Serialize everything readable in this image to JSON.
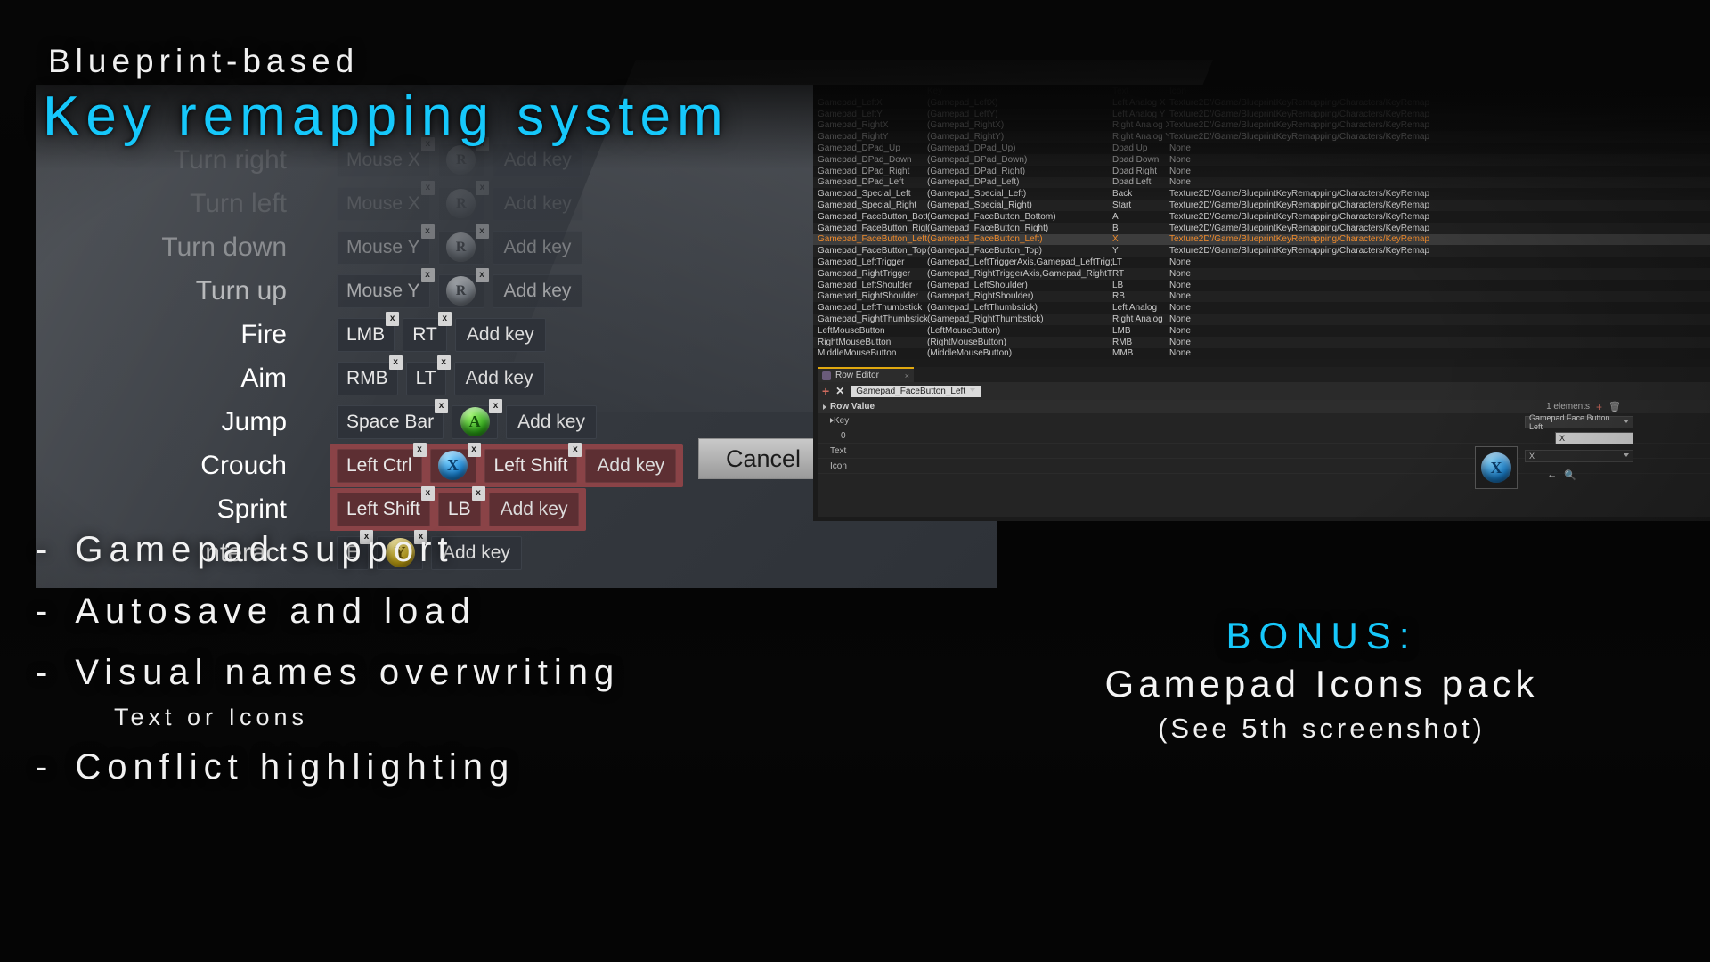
{
  "marketing": {
    "eyebrow": "Blueprint-based",
    "headline": "Key remapping system",
    "bullets": [
      {
        "dash": "-",
        "text": "Gamepad support"
      },
      {
        "dash": "-",
        "text": "Autosave and load"
      },
      {
        "dash": "-",
        "text": "Visual names overwriting",
        "sub": "Text or Icons"
      },
      {
        "dash": "-",
        "text": "Conflict highlighting"
      }
    ],
    "bonus": {
      "line1": "BONUS:",
      "line2": "Gamepad Icons pack",
      "line3": "(See 5th screenshot)"
    },
    "accent_color": "#16c8fb"
  },
  "game_menu": {
    "cancel_label": "Cancel",
    "add_key_label": "Add key",
    "remove_glyph": "x",
    "bindings": [
      {
        "action": "Turn right",
        "opacity": "ghost",
        "keys": [
          {
            "type": "text",
            "label": "Mouse X"
          },
          {
            "type": "pad",
            "glyph": "R",
            "color": "grey"
          }
        ],
        "conflict": false
      },
      {
        "action": "Turn left",
        "opacity": "ghost",
        "keys": [
          {
            "type": "text",
            "label": "Mouse X"
          },
          {
            "type": "pad",
            "glyph": "R",
            "color": "grey"
          }
        ],
        "conflict": false
      },
      {
        "action": "Turn down",
        "opacity": "fade1",
        "keys": [
          {
            "type": "text",
            "label": "Mouse Y"
          },
          {
            "type": "pad",
            "glyph": "R",
            "color": "grey"
          }
        ],
        "conflict": false
      },
      {
        "action": "Turn up",
        "opacity": "fade2",
        "keys": [
          {
            "type": "text",
            "label": "Mouse Y"
          },
          {
            "type": "pad",
            "glyph": "R",
            "color": "grey"
          }
        ],
        "conflict": false
      },
      {
        "action": "Fire",
        "opacity": "",
        "keys": [
          {
            "type": "text",
            "label": "LMB"
          },
          {
            "type": "text",
            "label": "RT"
          }
        ],
        "conflict": false
      },
      {
        "action": "Aim",
        "opacity": "",
        "keys": [
          {
            "type": "text",
            "label": "RMB"
          },
          {
            "type": "text",
            "label": "LT"
          }
        ],
        "conflict": false
      },
      {
        "action": "Jump",
        "opacity": "",
        "keys": [
          {
            "type": "text",
            "label": "Space Bar"
          },
          {
            "type": "pad",
            "glyph": "A",
            "color": "green"
          }
        ],
        "conflict": false
      },
      {
        "action": "Crouch",
        "opacity": "",
        "keys": [
          {
            "type": "text",
            "label": "Left Ctrl"
          },
          {
            "type": "pad",
            "glyph": "X",
            "color": "blue"
          },
          {
            "type": "text",
            "label": "Left Shift"
          }
        ],
        "conflict": true
      },
      {
        "action": "Sprint",
        "opacity": "",
        "keys": [
          {
            "type": "text",
            "label": "Left Shift"
          },
          {
            "type": "text",
            "label": "LB"
          }
        ],
        "conflict": true
      },
      {
        "action": "Interact",
        "opacity": "",
        "keys": [
          {
            "type": "text",
            "label": "E"
          },
          {
            "type": "pad",
            "glyph": "Y",
            "color": "yellow"
          }
        ],
        "conflict": false
      }
    ]
  },
  "editor": {
    "table": {
      "columns": [
        "",
        "Key",
        "Text",
        "Icon"
      ],
      "rows": [
        {
          "name": "Gamepad_LeftX",
          "key": "(Gamepad_LeftX)",
          "text": "Left Analog X",
          "icon": "Texture2D'/Game/BlueprintKeyRemapping/Characters/KeyRemap",
          "selected": false
        },
        {
          "name": "Gamepad_LeftY",
          "key": "(Gamepad_LeftY)",
          "text": "Left Analog Y",
          "icon": "Texture2D'/Game/BlueprintKeyRemapping/Characters/KeyRemap",
          "selected": false
        },
        {
          "name": "Gamepad_RightX",
          "key": "(Gamepad_RightX)",
          "text": "Right Analog X",
          "icon": "Texture2D'/Game/BlueprintKeyRemapping/Characters/KeyRemap",
          "selected": false
        },
        {
          "name": "Gamepad_RightY",
          "key": "(Gamepad_RightY)",
          "text": "Right Analog Y",
          "icon": "Texture2D'/Game/BlueprintKeyRemapping/Characters/KeyRemap",
          "selected": false
        },
        {
          "name": "Gamepad_DPad_Up",
          "key": "(Gamepad_DPad_Up)",
          "text": "Dpad Up",
          "icon": "None",
          "selected": false
        },
        {
          "name": "Gamepad_DPad_Down",
          "key": "(Gamepad_DPad_Down)",
          "text": "Dpad Down",
          "icon": "None",
          "selected": false
        },
        {
          "name": "Gamepad_DPad_Right",
          "key": "(Gamepad_DPad_Right)",
          "text": "Dpad Right",
          "icon": "None",
          "selected": false
        },
        {
          "name": "Gamepad_DPad_Left",
          "key": "(Gamepad_DPad_Left)",
          "text": "Dpad Left",
          "icon": "None",
          "selected": false
        },
        {
          "name": "Gamepad_Special_Left",
          "key": "(Gamepad_Special_Left)",
          "text": "Back",
          "icon": "Texture2D'/Game/BlueprintKeyRemapping/Characters/KeyRemap",
          "selected": false
        },
        {
          "name": "Gamepad_Special_Right",
          "key": "(Gamepad_Special_Right)",
          "text": "Start",
          "icon": "Texture2D'/Game/BlueprintKeyRemapping/Characters/KeyRemap",
          "selected": false
        },
        {
          "name": "Gamepad_FaceButton_Bottom",
          "key": "(Gamepad_FaceButton_Bottom)",
          "text": "A",
          "icon": "Texture2D'/Game/BlueprintKeyRemapping/Characters/KeyRemap",
          "selected": false
        },
        {
          "name": "Gamepad_FaceButton_Right",
          "key": "(Gamepad_FaceButton_Right)",
          "text": "B",
          "icon": "Texture2D'/Game/BlueprintKeyRemapping/Characters/KeyRemap",
          "selected": false
        },
        {
          "name": "Gamepad_FaceButton_Left",
          "key": "(Gamepad_FaceButton_Left)",
          "text": "X",
          "icon": "Texture2D'/Game/BlueprintKeyRemapping/Characters/KeyRemap",
          "selected": true
        },
        {
          "name": "Gamepad_FaceButton_Top",
          "key": "(Gamepad_FaceButton_Top)",
          "text": "Y",
          "icon": "Texture2D'/Game/BlueprintKeyRemapping/Characters/KeyRemap",
          "selected": false
        },
        {
          "name": "Gamepad_LeftTrigger",
          "key": "(Gamepad_LeftTriggerAxis,Gamepad_LeftTrigger)",
          "text": "LT",
          "icon": "None",
          "selected": false
        },
        {
          "name": "Gamepad_RightTrigger",
          "key": "(Gamepad_RightTriggerAxis,Gamepad_RightTrigger)",
          "text": "RT",
          "icon": "None",
          "selected": false
        },
        {
          "name": "Gamepad_LeftShoulder",
          "key": "(Gamepad_LeftShoulder)",
          "text": "LB",
          "icon": "None",
          "selected": false
        },
        {
          "name": "Gamepad_RightShoulder",
          "key": "(Gamepad_RightShoulder)",
          "text": "RB",
          "icon": "None",
          "selected": false
        },
        {
          "name": "Gamepad_LeftThumbstick",
          "key": "(Gamepad_LeftThumbstick)",
          "text": "Left Analog",
          "icon": "None",
          "selected": false
        },
        {
          "name": "Gamepad_RightThumbstick",
          "key": "(Gamepad_RightThumbstick)",
          "text": "Right Analog",
          "icon": "None",
          "selected": false
        },
        {
          "name": "LeftMouseButton",
          "key": "(LeftMouseButton)",
          "text": "LMB",
          "icon": "None",
          "selected": false
        },
        {
          "name": "RightMouseButton",
          "key": "(RightMouseButton)",
          "text": "RMB",
          "icon": "None",
          "selected": false
        },
        {
          "name": "MiddleMouseButton",
          "key": "(MiddleMouseButton)",
          "text": "MMB",
          "icon": "None",
          "selected": false
        }
      ]
    },
    "row_editor": {
      "tab_label": "Row Editor",
      "tab_close": "×",
      "add_label": "+",
      "remove_label": "✕",
      "selected_row": "Gamepad_FaceButton_Left",
      "section_label": "Row Value",
      "properties": [
        {
          "label": "Key"
        },
        {
          "label": "0"
        },
        {
          "label": "Text"
        },
        {
          "label": "Icon"
        }
      ],
      "elements_count": "1 elements",
      "key_value": "Gamepad Face Button Left",
      "text_value": "X",
      "icon_value": "X"
    }
  }
}
